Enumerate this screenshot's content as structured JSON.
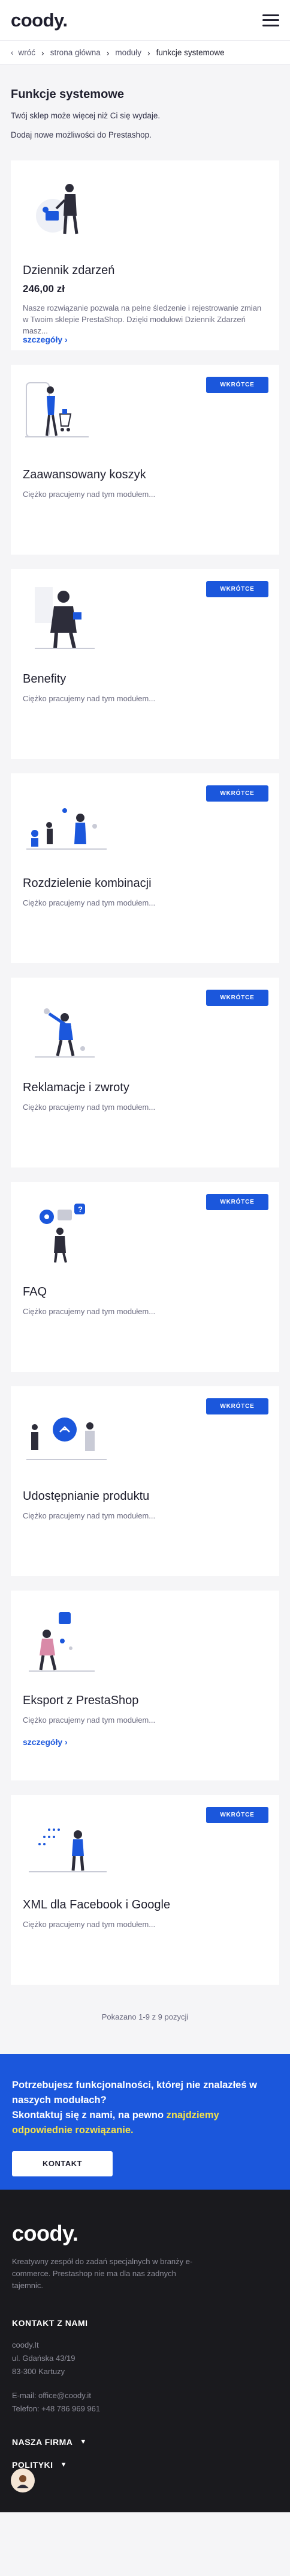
{
  "header": {
    "logo": "coody."
  },
  "breadcrumb": {
    "back": "wróć",
    "home": "strona główna",
    "modules": "moduły",
    "current": "funkcje systemowe"
  },
  "intro": {
    "title": "Funkcje systemowe",
    "line1": "Twój sklep może więcej niż Ci się wydaje.",
    "line2": "Dodaj nowe możliwości do Prestashop."
  },
  "cards": [
    {
      "title": "Dziennik zdarzeń",
      "price": "246,00 zł",
      "desc": "Nasze rozwiązanie pozwala na pełne śledzenie i rejestrowanie zmian w Twoim sklepie PrestaShop. Dzięki modułowi Dziennik Zdarzeń masz...",
      "more": "szczegóły ›",
      "badge": ""
    },
    {
      "title": "Zaawansowany koszyk",
      "price": "",
      "desc": "Ciężko pracujemy nad tym modułem...",
      "more": "",
      "badge": "WKRÓTCE"
    },
    {
      "title": "Benefity",
      "price": "",
      "desc": "Ciężko pracujemy nad tym modułem...",
      "more": "",
      "badge": "WKRÓTCE"
    },
    {
      "title": "Rozdzielenie kombinacji",
      "price": "",
      "desc": "Ciężko pracujemy nad tym modułem...",
      "more": "",
      "badge": "WKRÓTCE"
    },
    {
      "title": "Reklamacje i zwroty",
      "price": "",
      "desc": "Ciężko pracujemy nad tym modułem...",
      "more": "",
      "badge": "WKRÓTCE"
    },
    {
      "title": "FAQ",
      "price": "",
      "desc": "Ciężko pracujemy nad tym modułem...",
      "more": "",
      "badge": "WKRÓTCE"
    },
    {
      "title": "Udostępnianie produktu",
      "price": "",
      "desc": "Ciężko pracujemy nad tym modułem...",
      "more": "",
      "badge": "WKRÓTCE"
    },
    {
      "title": "Eksport z PrestaShop",
      "price": "",
      "desc": "Ciężko pracujemy nad tym modułem...",
      "more": "szczegóły ›",
      "badge": ""
    },
    {
      "title": "XML dla Facebook i Google",
      "price": "",
      "desc": "Ciężko pracujemy nad tym modułem...",
      "more": "",
      "badge": "WKRÓTCE"
    }
  ],
  "pagination": {
    "count": "Pokazano 1-9 z 9 pozycji"
  },
  "cta": {
    "text_a": "Potrzebujesz funkcjonalności, której nie znalazłeś w naszych modułach?",
    "text_b": "Skontaktuj się z nami, na pewno ",
    "text_highlight": "znajdziemy odpowiednie rozwiązanie.",
    "button": "KONTAKT"
  },
  "footer": {
    "logo": "coody.",
    "desc": "Kreatywny zespół do zadań specjalnych w branży e-commerce. Prestashop nie ma dla nas żadnych tajemnic.",
    "contact_title": "KONTAKT Z NAMI",
    "company": "coody.It",
    "street": "ul. Gdańska 43/19",
    "city": "83-300 Kartuzy",
    "email": "E-mail: office@coody.it",
    "phone": "Telefon: +48 786 969 961",
    "company_section": "NASZA FIRMA",
    "policies_section": "POLITYKI"
  },
  "colors": {
    "accent": "#1b57dc",
    "highlight": "#f3e14a",
    "footer_bg": "#1a1a1e"
  }
}
